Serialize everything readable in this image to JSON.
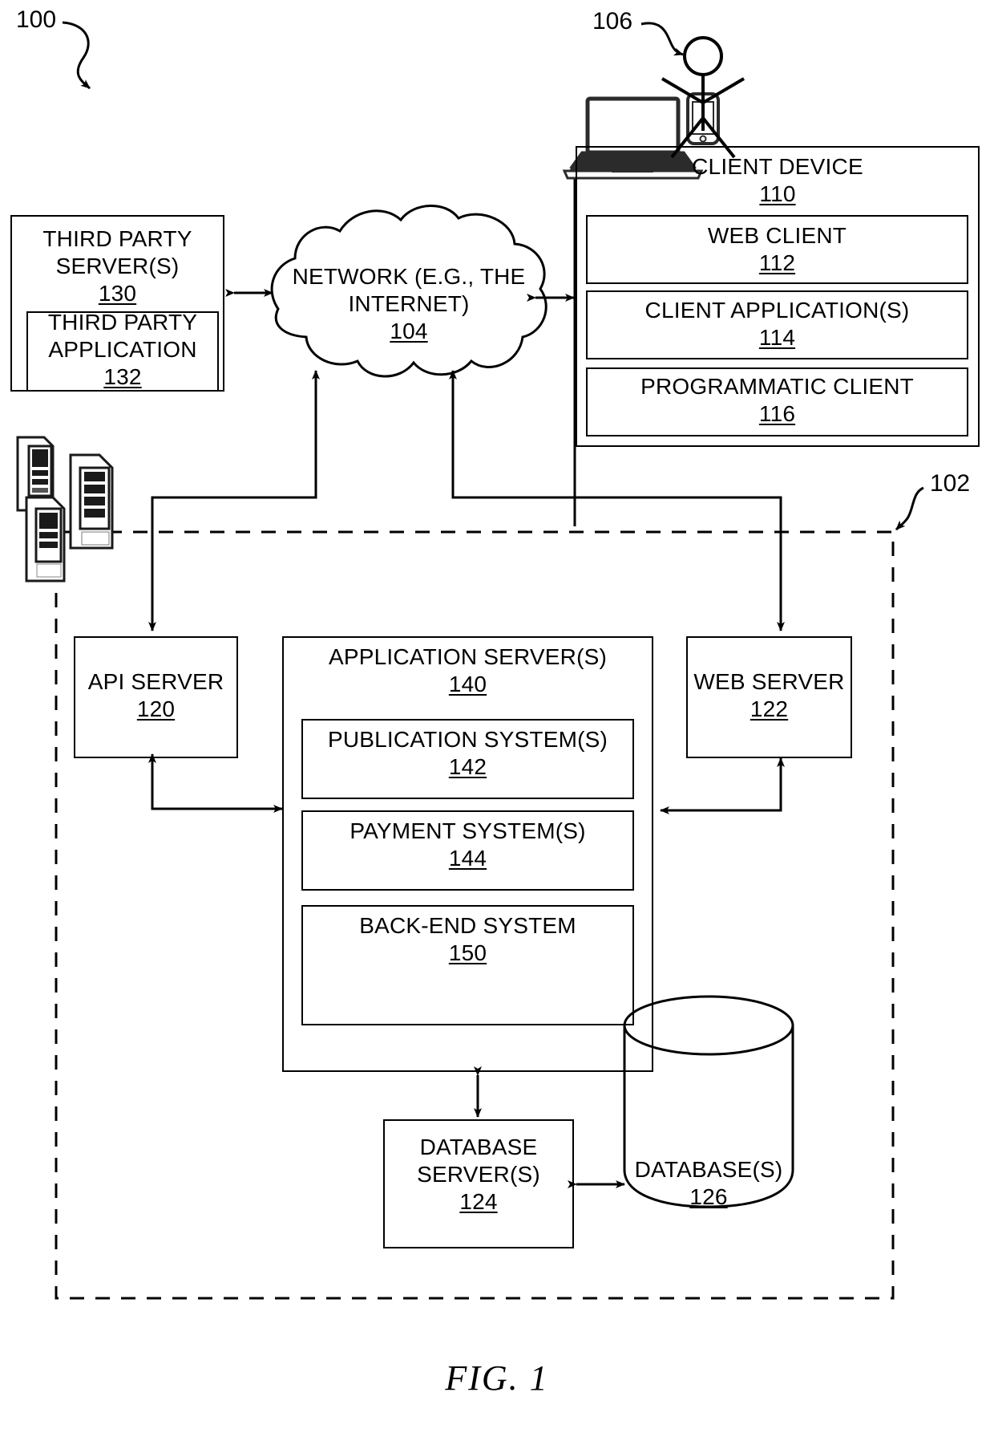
{
  "figure": {
    "caption": "FIG. 1",
    "ref_system": "100",
    "ref_user": "106",
    "ref_networked_system": "102"
  },
  "third_party": {
    "server_title_line1": "THIRD PARTY",
    "server_title_line2": "SERVER(S)",
    "server_num": "130",
    "app_title_line1": "THIRD PARTY",
    "app_title_line2": "APPLICATION",
    "app_num": "132"
  },
  "network": {
    "line1": "NETWORK (E.G., THE",
    "line2": "INTERNET)",
    "num": "104"
  },
  "client_device": {
    "title": "CLIENT DEVICE",
    "num": "110",
    "items": [
      {
        "title": "WEB CLIENT",
        "num": "112"
      },
      {
        "title": "CLIENT APPLICATION(S)",
        "num": "114"
      },
      {
        "title": "PROGRAMMATIC CLIENT",
        "num": "116"
      }
    ],
    "icons": {
      "laptop": "laptop-icon",
      "phone": "mobile-phone-icon",
      "user": "user-stick-figure-icon"
    }
  },
  "networked_system": {
    "api_server": {
      "title": "API SERVER",
      "num": "120"
    },
    "web_server": {
      "title": "WEB SERVER",
      "num": "122"
    },
    "application_server": {
      "title": "APPLICATION SERVER(S)",
      "num": "140",
      "subsystems": [
        {
          "title": "PUBLICATION SYSTEM(S)",
          "num": "142"
        },
        {
          "title": "PAYMENT SYSTEM(S)",
          "num": "144"
        },
        {
          "title": "BACK-END SYSTEM",
          "num": "150"
        }
      ]
    },
    "database_server": {
      "title_line1": "DATABASE",
      "title_line2": "SERVER(S)",
      "num": "124"
    },
    "database": {
      "title": "DATABASE(S)",
      "num": "126"
    },
    "server_stack_icon": "server-rack-icon"
  },
  "colors": {
    "stroke": "#000000",
    "background": "#ffffff",
    "icon_fill": "#1a1a1a"
  }
}
